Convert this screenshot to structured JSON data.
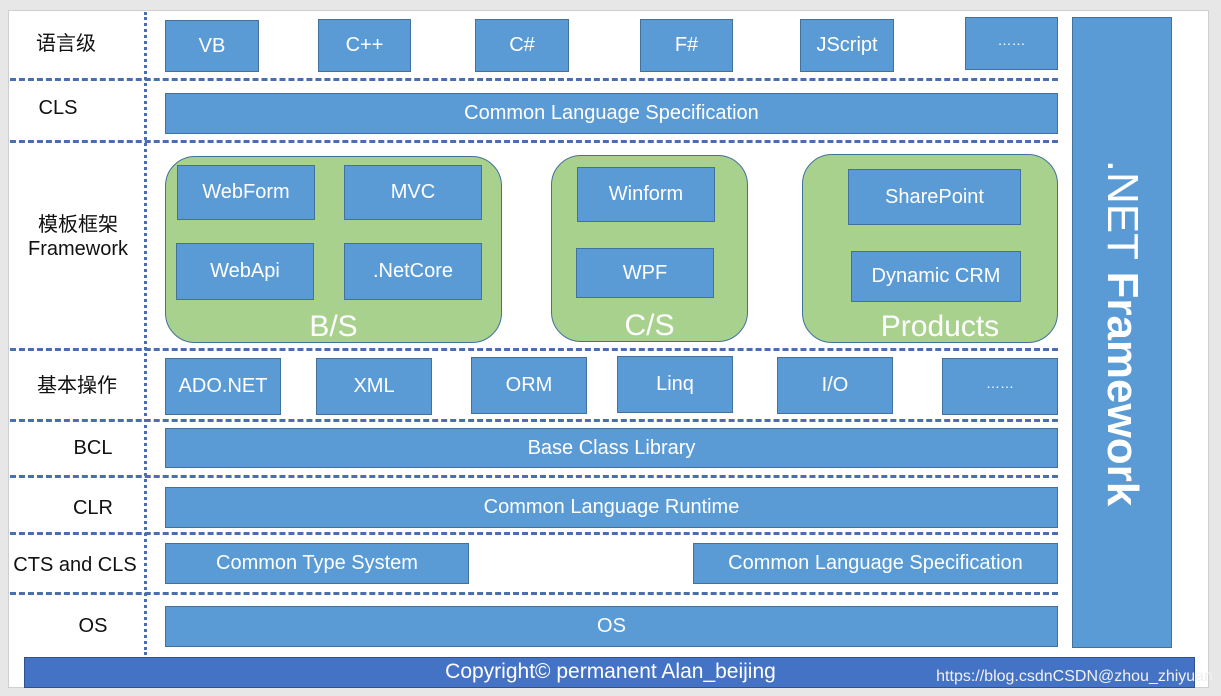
{
  "rows": {
    "language": {
      "label": "语言级",
      "items": [
        "VB",
        "C++",
        "C#",
        "F#",
        "JScript",
        "……"
      ]
    },
    "cls": {
      "label": "CLS",
      "bar": "Common Language Specification"
    },
    "framework": {
      "label_cn": "模板框架",
      "label_en": "Framework",
      "groups": [
        {
          "name": "B/S",
          "items": [
            "WebForm",
            "MVC",
            "WebApi",
            ".NetCore"
          ]
        },
        {
          "name": "C/S",
          "items": [
            "Winform",
            "WPF"
          ]
        },
        {
          "name": "Products",
          "items": [
            "SharePoint",
            "Dynamic CRM"
          ]
        }
      ]
    },
    "basic_ops": {
      "label": "基本操作",
      "items": [
        "ADO.NET",
        "XML",
        "ORM",
        "Linq",
        "I/O",
        "……"
      ]
    },
    "bcl": {
      "label": "BCL",
      "bar": "Base Class Library"
    },
    "clr": {
      "label": "CLR",
      "bar": "Common Language Runtime"
    },
    "cts_cls": {
      "label": "CTS and CLS",
      "left": "Common Type System",
      "right": "Common Language Specification"
    },
    "os": {
      "label": "OS",
      "bar": "OS"
    }
  },
  "side_banner": {
    "part1": ".NET",
    "part2": "Framework"
  },
  "footer": {
    "copyright": "Copyright© permanent  Alan_beijing"
  },
  "watermark": "https://blog.csdnCSDN@zhou_zhiyuan",
  "colors": {
    "box": "#5b9bd5",
    "group": "#a9d18e",
    "footer": "#4472c4",
    "divider": "#4a6fb0"
  }
}
